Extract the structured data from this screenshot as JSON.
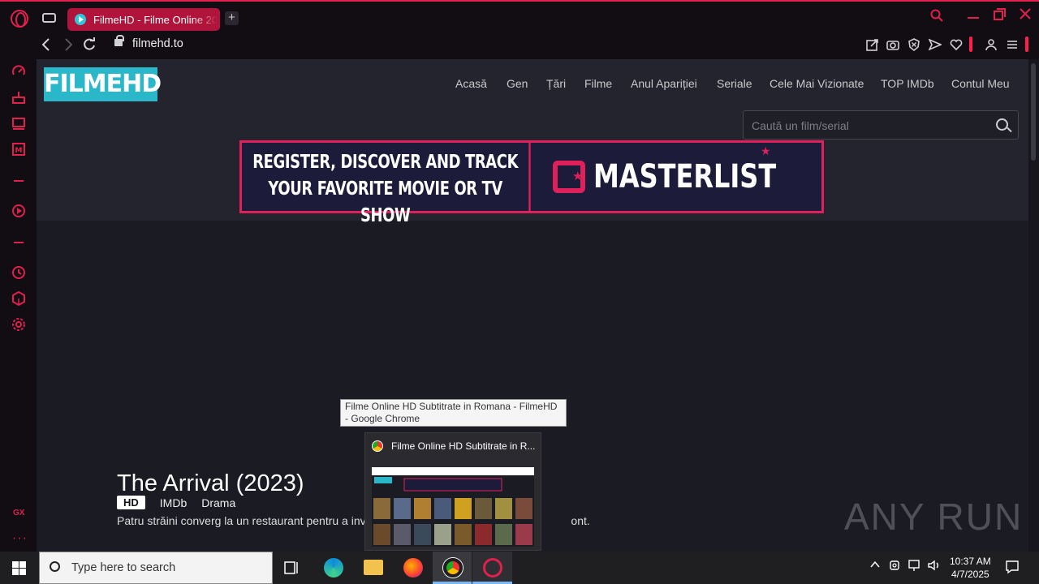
{
  "browser": {
    "tab_title": "FilmeHD - Filme Online 20",
    "url": "filmehd.to",
    "new_tab": "+"
  },
  "site": {
    "logo": "FILMEHD",
    "nav": [
      "Acasă",
      "Gen",
      "Țări",
      "Filme",
      "Anul Apariției",
      "Seriale",
      "Cele Mai Vizionate",
      "TOP IMDb",
      "Contul Meu"
    ],
    "search_placeholder": "Caută un film/serial",
    "banner_line1": "REGISTER, DISCOVER AND TRACK",
    "banner_line2": "YOUR FAVORITE  MOVIE OR TV SHOW",
    "banner_brand": "MASTERLIST"
  },
  "hero": {
    "title": "The Arrival (2023)",
    "badge": "HD",
    "imdb": "IMDb",
    "genre": "Drama",
    "description_start": "Patru străini converg la un restaurant pentru a inve",
    "description_end": "ont."
  },
  "tooltip": {
    "text": "Filme Online HD Subtitrate in Romana - FilmeHD - Google Chrome"
  },
  "preview": {
    "title": "Filme Online HD Subtitrate in R..."
  },
  "sidebar": {
    "gx_label": "GX",
    "more": "···"
  },
  "watermark": "ANY RUN",
  "taskbar": {
    "search_placeholder": "Type here to search",
    "time": "10:37 AM",
    "date": "4/7/2025"
  },
  "colors": {
    "accent": "#e0204d",
    "logo_bg": "#2ab7c9",
    "page_bg": "#1a1b23"
  }
}
